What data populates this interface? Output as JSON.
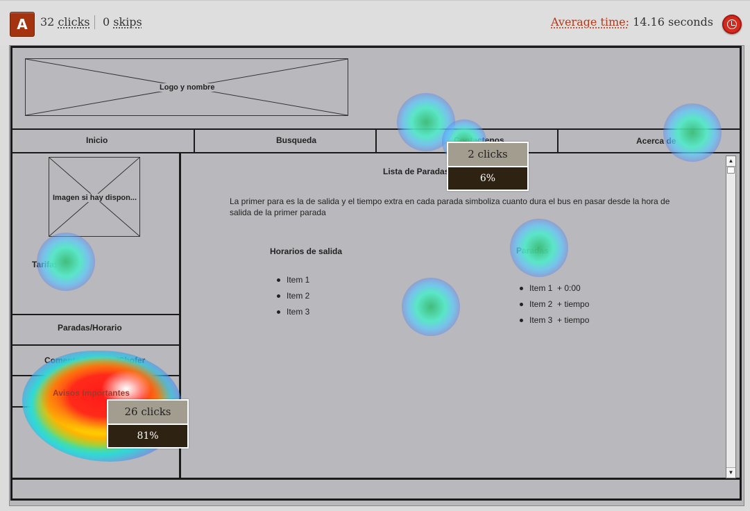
{
  "header": {
    "variant": "A",
    "clicks_count": "32",
    "clicks_label": "clicks",
    "skips_count": "0",
    "skips_label": "skips",
    "avg_label": "Average time:",
    "avg_value": "14.16 seconds"
  },
  "wireframe": {
    "logo_text": "Logo y nombre",
    "nav": [
      "Inicio",
      "Busqueda",
      "Contactenos",
      "Acerca de"
    ],
    "image_text": "Imagen si hay dispon...",
    "tarifa": "Tarifa:",
    "side_menu": [
      "Paradas/Horario",
      "Comentarios Ruta/Chofer",
      "Avisos Importantes"
    ],
    "content_title": "Lista de Paradas",
    "description_line1": "La primer para es la de salida y el tiempo extra en cada parada simboliza cuanto dura el bus en pasar desde la hora de",
    "description_line2": "salida de la primer parada",
    "horarios_title": "Horarios de salida",
    "horarios_items": [
      "Item 1",
      "Item 2",
      "Item 3"
    ],
    "paradas_title": "Paradas",
    "paradas_items": [
      "Item 1  + 0:00",
      "Item 2  + tiempo",
      "Item 3  + tiempo"
    ]
  },
  "tooltips": [
    {
      "clicks": "2 clicks",
      "percent": "6%"
    },
    {
      "clicks": "26 clicks",
      "percent": "81%"
    }
  ]
}
